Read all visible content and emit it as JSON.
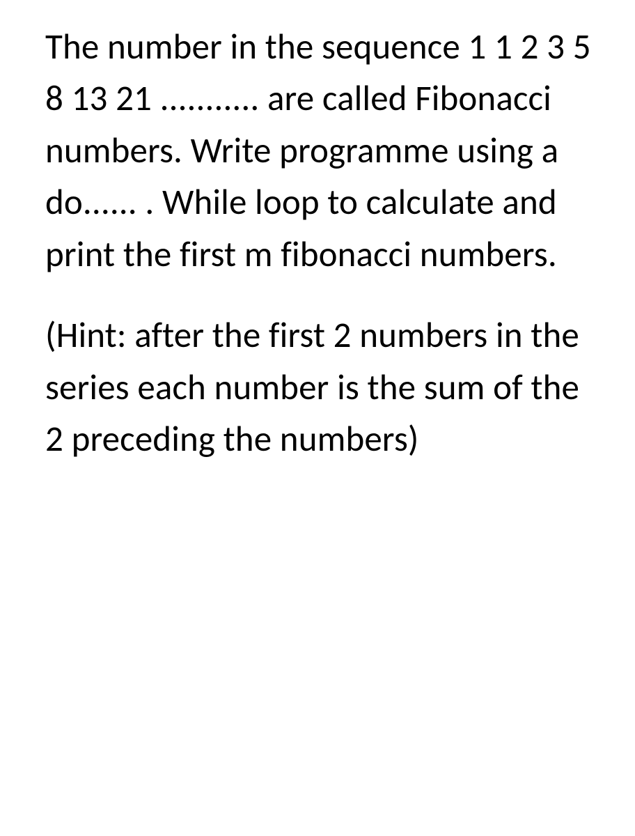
{
  "paragraphs": {
    "p1": "The number in the sequence 1 1 2 3 5 8 13 21 ........... are called Fibonacci numbers. Write programme using a do...... . While loop to calculate and print the first m fibonacci numbers.",
    "p2": "(Hint: after the first 2 numbers in the series each number is the sum of the 2 preceding the numbers)"
  }
}
